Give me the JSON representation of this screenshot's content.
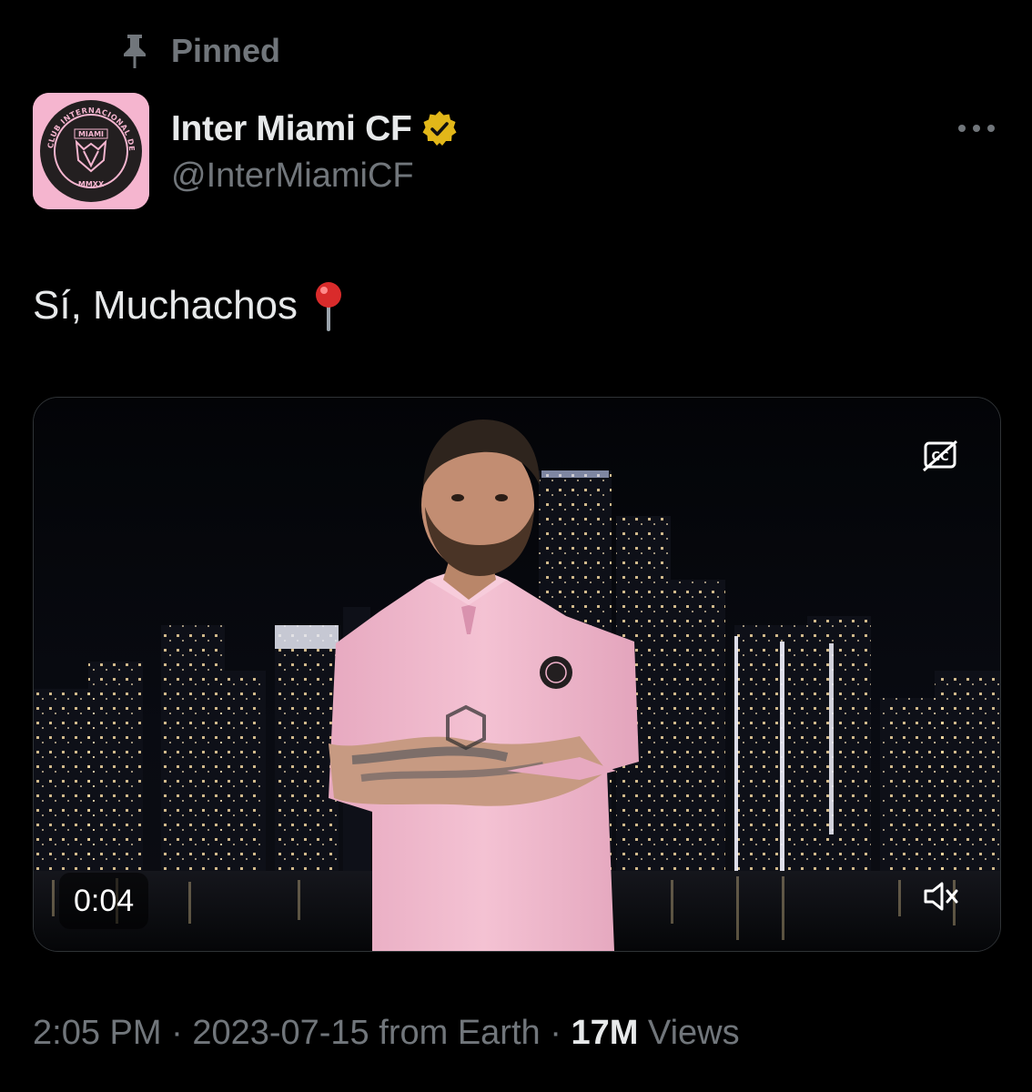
{
  "pinned": {
    "label": "Pinned",
    "icon": "pin-icon"
  },
  "author": {
    "display_name": "Inter Miami CF",
    "handle": "@InterMiamiCF",
    "verified_icon": "verified-badge-icon",
    "verified_color": "#e2b719",
    "avatar": {
      "icon": "inter-miami-crest",
      "background": "#f5b5cf",
      "crest_text": [
        "CLUB INTERNACIONAL DE FÚTBOL",
        "MIAMI",
        "MMXX"
      ]
    }
  },
  "more_icon": "more-horizontal-icon",
  "tweet": {
    "text": "Sí, Muchachos",
    "emoji": "round-pushpin"
  },
  "media": {
    "type": "video",
    "duration": "0:04",
    "cc_icon": "closed-captions-off-icon",
    "mute_icon": "muted-speaker-icon",
    "shirt_color": "#f2bcd0"
  },
  "meta": {
    "time": "2:05 PM",
    "separator": "·",
    "date": "2023-07-15",
    "source": "from Earth",
    "views_count": "17M",
    "views_label": "Views"
  },
  "colors": {
    "background": "#000000",
    "primary_text": "#e7e9ea",
    "secondary_text": "#71767b"
  }
}
